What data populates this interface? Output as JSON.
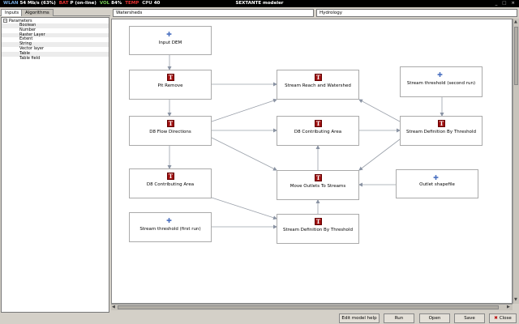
{
  "status_bar": {
    "wlan_label": "WLAN",
    "wlan_value": "54 Mb/s (63%)",
    "bat_label": "BAT",
    "bat_value": "P (on-line)",
    "vol_label": "VOL",
    "vol_value": "84%",
    "temp_label": "TEMP",
    "cpu_label": "CPU",
    "cpu_value": "40",
    "window_title": "SEXTANTE modeler",
    "window_controls": "_ □ ×"
  },
  "left_panel": {
    "tabs": [
      {
        "label": "Inputs",
        "active": true
      },
      {
        "label": "Algorithms",
        "active": false
      }
    ],
    "tree": {
      "root": {
        "label": "Parameters",
        "toggle": "−"
      },
      "items": [
        {
          "label": "Boolean"
        },
        {
          "label": "Number"
        },
        {
          "label": "Raster Layer"
        },
        {
          "label": "Extent"
        },
        {
          "label": "String"
        },
        {
          "label": "Vector layer"
        },
        {
          "label": "Table"
        },
        {
          "label": "Table field"
        }
      ]
    }
  },
  "model": {
    "name": "Watersheds",
    "group": "Hydrology"
  },
  "nodes": [
    {
      "id": "input_dem",
      "label": "Input DEM",
      "icon": "plus-icon"
    },
    {
      "id": "pit_remove",
      "label": "Pit Remove",
      "icon": "taudem-icon"
    },
    {
      "id": "stream_reach",
      "label": "Stream Reach and Watershed",
      "icon": "taudem-icon"
    },
    {
      "id": "threshold2",
      "label": "Stream threshold (second run)",
      "icon": "plus-icon"
    },
    {
      "id": "d8_flow",
      "label": "D8 Flow Directions",
      "icon": "taudem-icon"
    },
    {
      "id": "d8_contrib1",
      "label": "D8 Contributing Area",
      "icon": "taudem-icon"
    },
    {
      "id": "stream_def2",
      "label": "Stream Definition By Threshold",
      "icon": "taudem-icon"
    },
    {
      "id": "d8_contrib2",
      "label": "D8 Contributing Area",
      "icon": "taudem-icon"
    },
    {
      "id": "move_outlets",
      "label": "Move Outlets To Streams",
      "icon": "taudem-icon"
    },
    {
      "id": "outlet_shp",
      "label": "Outlet shapefile",
      "icon": "plus-icon"
    },
    {
      "id": "threshold1",
      "label": "Stream threshold (first run)",
      "icon": "plus-icon"
    },
    {
      "id": "stream_def1",
      "label": "Stream Definition By Threshold",
      "icon": "taudem-icon"
    }
  ],
  "icon_glyphs": {
    "taudem": "T",
    "plus": "✚"
  },
  "buttons": {
    "help": "Edit model help",
    "run": "Run",
    "open": "Open",
    "save": "Save",
    "close": "Close"
  },
  "colors": {
    "taudem_icon": "#a01010",
    "input_icon": "#4a70c0",
    "edge": "#9aa0aa"
  }
}
